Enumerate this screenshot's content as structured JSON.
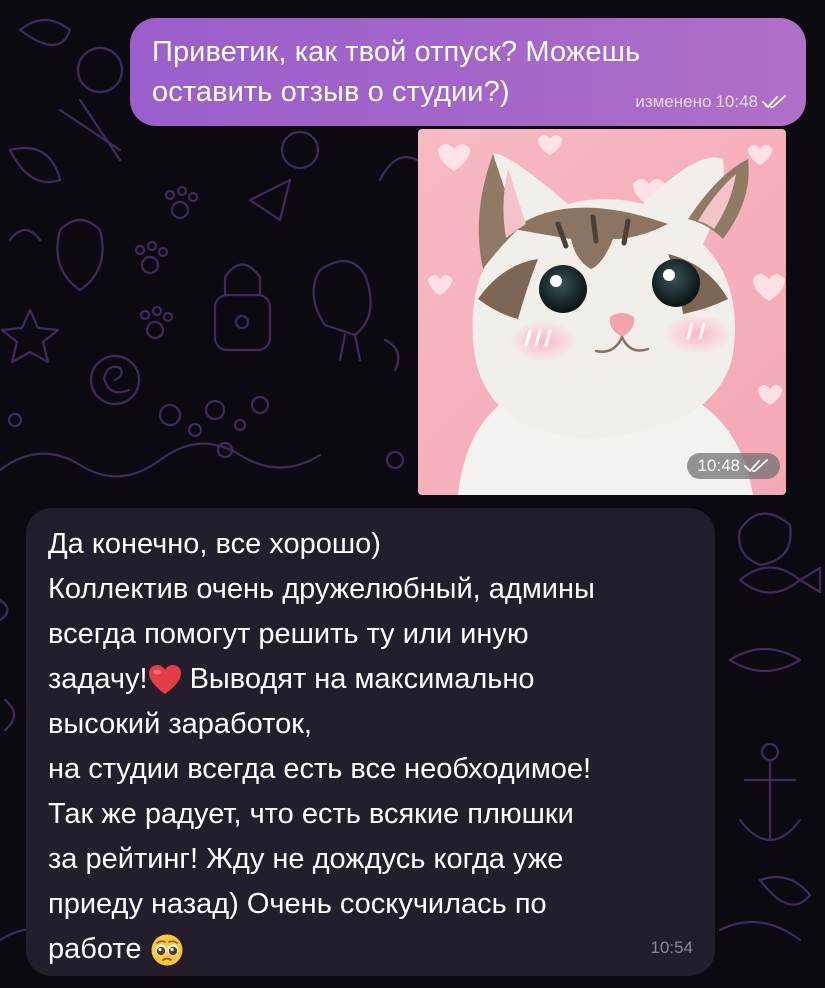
{
  "chat": {
    "outgoing_message": {
      "text_line1": "Приветик, как твой отпуск? Можешь",
      "text_line2": "оставить отзыв о студии?)",
      "edited_label": "изменено",
      "time": "10:48"
    },
    "photo_message": {
      "time": "10:48"
    },
    "incoming_message": {
      "lines": [
        "Да конечно, все хорошо)",
        "Коллектив очень дружелюбный, админы",
        "всегда помогут решить ту или иную",
        "задачу!",
        " Выводят на максимально",
        "высокий заработок,",
        "на студии всегда есть все необходимое!",
        "Так же радует, что есть всякие плюшки",
        "за рейтинг! Жду не дождусь когда уже",
        "приеду назад) Очень соскучилась по",
        "работе"
      ],
      "time": "10:54"
    }
  },
  "icons": {
    "read_receipt": "double-check-icon",
    "heart_emoji": "red-heart-emoji",
    "pleading_emoji": "pleading-face-emoji"
  },
  "colors": {
    "background": "#0c0a10",
    "outgoing_bubble": "#a466c9",
    "incoming_bubble": "#241e2c",
    "doodle_pattern": "#4a2f6a"
  }
}
